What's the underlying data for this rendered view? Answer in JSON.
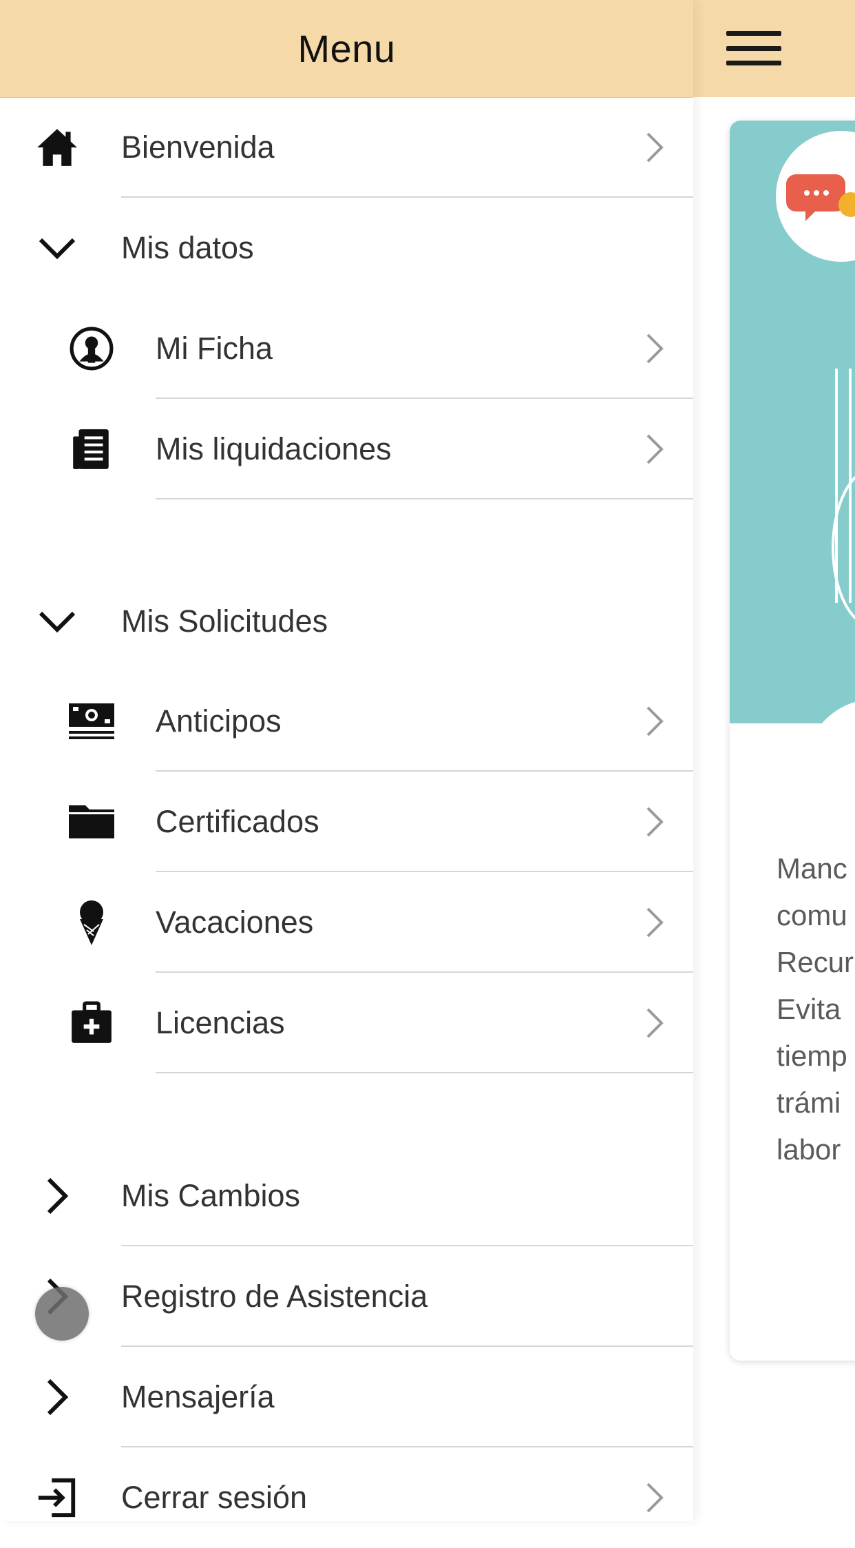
{
  "drawer": {
    "title": "Menu",
    "items": [
      {
        "label": "Bienvenida",
        "icon": "home-icon"
      },
      {
        "label": "Mis datos",
        "icon": "chevron-down-icon",
        "children": [
          {
            "label": "Mi Ficha",
            "icon": "user-circle-icon"
          },
          {
            "label": "Mis liquidaciones",
            "icon": "document-list-icon"
          }
        ]
      },
      {
        "label": "Mis Solicitudes",
        "icon": "chevron-down-icon",
        "children": [
          {
            "label": "Anticipos",
            "icon": "money-icon"
          },
          {
            "label": "Certificados",
            "icon": "folder-icon"
          },
          {
            "label": "Vacaciones",
            "icon": "ice-cream-icon"
          },
          {
            "label": "Licencias",
            "icon": "medical-kit-icon"
          }
        ]
      },
      {
        "label": "Mis Cambios",
        "icon": "chevron-right-icon"
      },
      {
        "label": "Registro de Asistencia",
        "icon": "chevron-right-icon"
      },
      {
        "label": "Mensajería",
        "icon": "chevron-right-icon"
      },
      {
        "label": "Cerrar sesión",
        "icon": "logout-icon"
      }
    ]
  },
  "background": {
    "menu_icon": "hamburger-icon",
    "card_text_lines": [
      "Manc",
      "comu",
      "Recur",
      "Evita",
      "tiemp",
      "trámi",
      "labor"
    ]
  },
  "colors": {
    "header_bg": "#f5d9a8",
    "illustration_bg": "#86cccc",
    "chat_bubble": "#e8604c"
  }
}
